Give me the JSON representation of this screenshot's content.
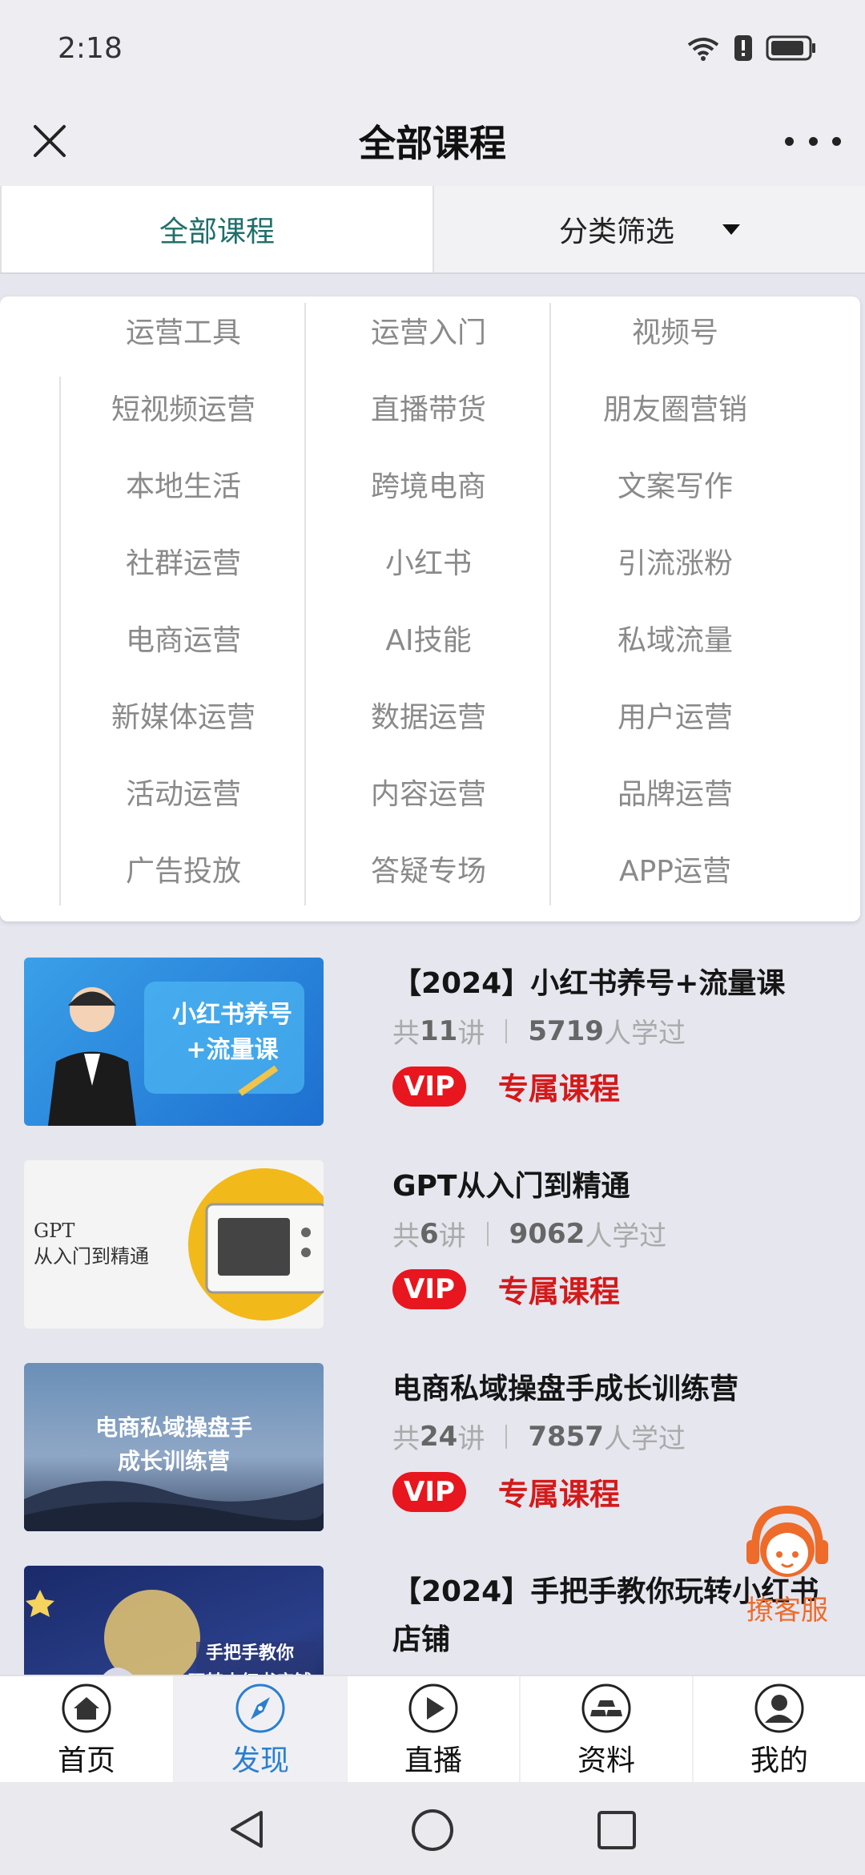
{
  "status": {
    "time": "2:18"
  },
  "header": {
    "title": "全部课程"
  },
  "tabs": {
    "all": "全部课程",
    "filter": "分类筛选"
  },
  "categories": [
    [
      "运营工具",
      "运营入门",
      "视频号"
    ],
    [
      "短视频运营",
      "直播带货",
      "朋友圈营销"
    ],
    [
      "本地生活",
      "跨境电商",
      "文案写作"
    ],
    [
      "社群运营",
      "小红书",
      "引流涨粉"
    ],
    [
      "电商运营",
      "AI技能",
      "私域流量"
    ],
    [
      "新媒体运营",
      "数据运营",
      "用户运营"
    ],
    [
      "活动运营",
      "内容运营",
      "品牌运营"
    ],
    [
      "广告投放",
      "答疑专场",
      "APP运营"
    ]
  ],
  "courses": [
    {
      "title": "【2024】小红书养号+流量课",
      "lessons_pre": "共",
      "lessons": "11",
      "lessons_post": "讲",
      "learners": "5719",
      "learners_post": "人学过",
      "vip": "VIP",
      "vip_text": "专属课程",
      "thumb_text": [
        "小红书养号",
        "+流量课"
      ]
    },
    {
      "title": "GPT从入门到精通",
      "lessons_pre": "共",
      "lessons": "6",
      "lessons_post": "讲",
      "learners": "9062",
      "learners_post": "人学过",
      "vip": "VIP",
      "vip_text": "专属课程",
      "thumb_text": [
        "GPT",
        "从入门到精通"
      ]
    },
    {
      "title": "电商私域操盘手成长训练营",
      "lessons_pre": "共",
      "lessons": "24",
      "lessons_post": "讲",
      "learners": "7857",
      "learners_post": "人学过",
      "vip": "VIP",
      "vip_text": "专属课程",
      "thumb_text": [
        "电商私域操盘手",
        "成长训练营"
      ]
    },
    {
      "title": "【2024】手把手教你玩转小红书店铺",
      "thumb_text": [
        "手把手教你",
        "玩转小红书店铺"
      ]
    }
  ],
  "customer_service": {
    "label": "撩客服"
  },
  "bottom_nav": [
    {
      "label": "首页",
      "icon": "home-icon"
    },
    {
      "label": "发现",
      "icon": "compass-icon"
    },
    {
      "label": "直播",
      "icon": "play-icon"
    },
    {
      "label": "资料",
      "icon": "gold-bars-icon"
    },
    {
      "label": "我的",
      "icon": "user-icon"
    }
  ],
  "colors": {
    "accent": "#1f6f6a",
    "vip": "#e8161e",
    "nav_active": "#2a7fd0",
    "cs_orange": "#ee6b2a"
  }
}
